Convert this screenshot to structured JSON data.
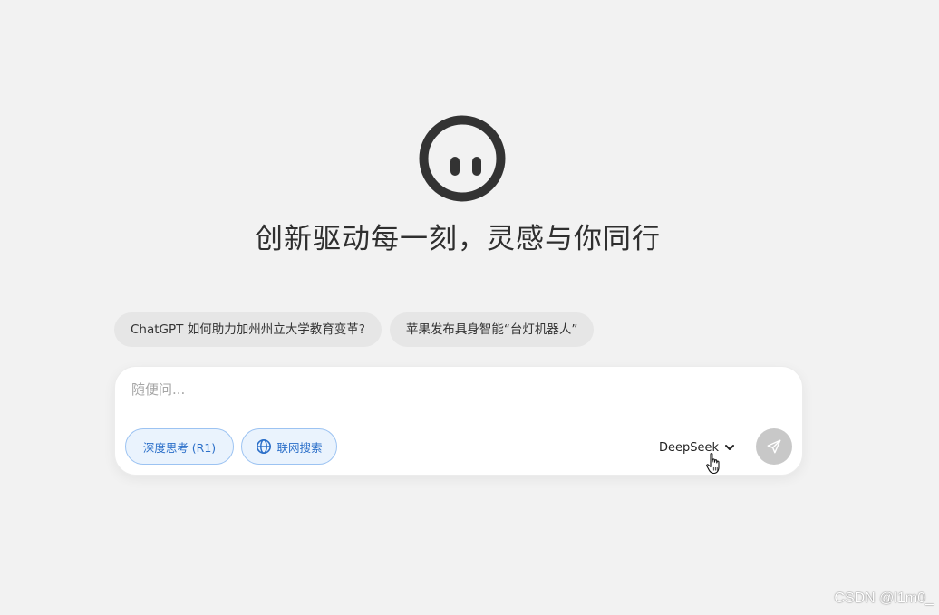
{
  "headline": "创新驱动每一刻，灵感与你同行",
  "suggestions": [
    {
      "label": "ChatGPT 如何助力加州州立大学教育变革?"
    },
    {
      "label": "苹果发布具身智能“台灯机器人”"
    }
  ],
  "chat": {
    "placeholder": "随便问...",
    "value": ""
  },
  "tools": {
    "deep_think_label": "深度思考 (R1)",
    "web_search_label": "联网搜索"
  },
  "model": {
    "selected": "DeepSeek"
  },
  "watermark": "CSDN @l1m0_",
  "icons": {
    "logo": "face-logo-icon",
    "globe": "globe-icon",
    "chevron": "chevron-down-icon",
    "send": "paper-plane-icon",
    "cursor": "hand-pointer-icon"
  },
  "colors": {
    "background": "#f2f2f2",
    "accent": "#2b6fc9",
    "accent_bg": "#eaf3fd",
    "accent_border": "#9cc3f2",
    "send_disabled": "#c8c8c8",
    "logo": "#333333"
  }
}
